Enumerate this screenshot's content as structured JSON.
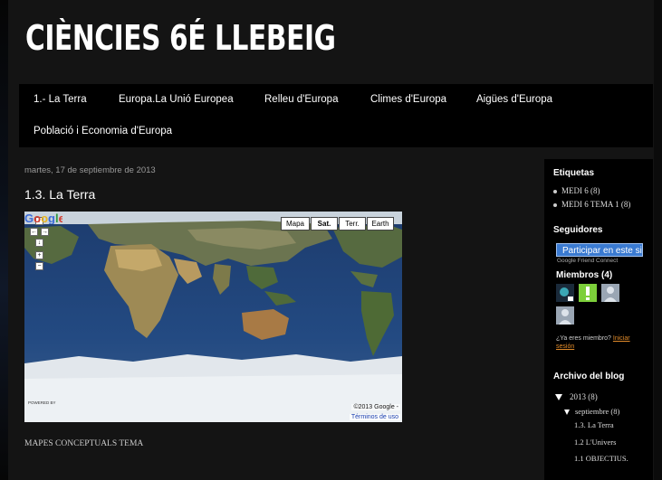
{
  "blog": {
    "title": "CIÈNCIES 6É LLEBEIG"
  },
  "nav": {
    "items": [
      "1.- La Terra",
      "Europa.La Unió Europea",
      "Relleu d'Europa",
      "Climes d'Europa",
      "Aigües d'Europa",
      "Població i Economia d'Europa"
    ]
  },
  "post": {
    "date": "martes, 17 de septiembre de 2013",
    "title": "1.3. La Terra",
    "below_text": "MAPES CONCEPTUALS TEMA"
  },
  "map": {
    "types": [
      "Mapa",
      "Sat.",
      "Terr.",
      "Earth"
    ],
    "active_type": "Sat.",
    "pan_icons": [
      "arrow-up-icon",
      "arrow-left-icon",
      "arrow-right-icon",
      "arrow-down-icon",
      "zoom-in-icon",
      "zoom-out-icon"
    ],
    "pan_glyphs": {
      "up": "↑",
      "left": "←",
      "right": "→",
      "down": "↓",
      "zoom_in": "+",
      "zoom_out": "−"
    },
    "powered_by": "POWERED BY",
    "logo": "Google",
    "copyright": "©2013 Google -",
    "terms": "Términos de uso"
  },
  "sidebar": {
    "labels_heading": "Etiquetas",
    "labels": [
      "MEDI 6 (8)",
      "MEDI 6 TEMA 1 (8)"
    ],
    "followers_heading": "Seguidores",
    "follow_button": "Participar en este si",
    "gfc": "Google Friend Connect",
    "members": "Miembros (4)",
    "already_member": "¿Ya eres miembro?",
    "sign_in": "Iniciar sesión",
    "archive_heading": "Archivo del blog",
    "archive_year": "2013 (8)",
    "archive_month": "septiembre (8)",
    "archive_posts": [
      "1.3. La Terra",
      "1.2 L'Univers",
      "1.1 OBJECTIUS."
    ]
  },
  "colors": {
    "background": "#141414",
    "panel": "#000000",
    "accent_link": "#e08a2a",
    "follow_button": "#3a7ad1"
  }
}
